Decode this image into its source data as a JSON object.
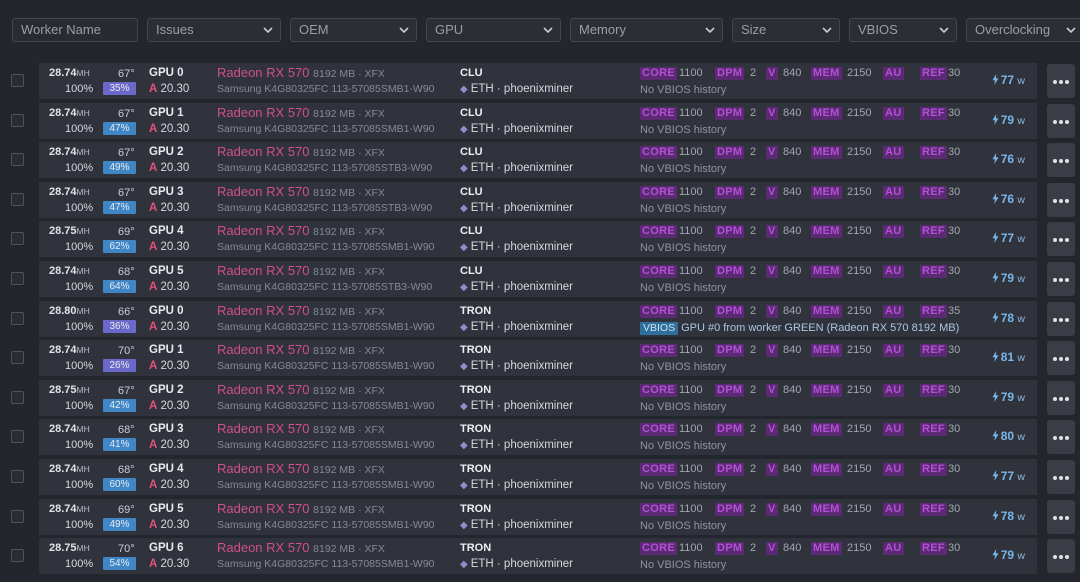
{
  "filters": {
    "worker_name_placeholder": "Worker Name",
    "issues": "Issues",
    "oem": "OEM",
    "gpu": "GPU",
    "memory": "Memory",
    "size": "Size",
    "vbios": "VBIOS",
    "overclocking": "Overclocking"
  },
  "oc_labels": {
    "core": "CORE",
    "dpm": "DPM",
    "v": "V",
    "mem": "MEM",
    "au": "AU",
    "ref": "REF"
  },
  "colors": {
    "accent_pink": "#d04f8c",
    "oc_tag_bg": "#5a2a73",
    "fan_blue": "#3f86c6",
    "fan_purple": "#6a68c8",
    "power_blue": "#78b6ea"
  },
  "rows": [
    {
      "hash": "28.74",
      "hash_unit": "MH",
      "pct": "100%",
      "temp": "67°",
      "fan": "35%",
      "fan_color": "purple",
      "gpu": "GPU 0",
      "amp_label": "A",
      "amp": "20.30",
      "model": "Radeon RX 570",
      "spec": "8192 MB · XFX",
      "memory": "Samsung K4G80325FC 113-57085SMB1-W90",
      "worker": "CLU",
      "algo": "ETH · phoenixminer",
      "core": "1100",
      "dpm": "2",
      "v": "840",
      "mem": "2150",
      "au": "",
      "ref": "30",
      "vbios_tag": "",
      "vbios_text": "No VBIOS history",
      "power": "77",
      "power_unit": "w"
    },
    {
      "hash": "28.74",
      "hash_unit": "MH",
      "pct": "100%",
      "temp": "67°",
      "fan": "47%",
      "fan_color": "blue",
      "gpu": "GPU 1",
      "amp_label": "A",
      "amp": "20.30",
      "model": "Radeon RX 570",
      "spec": "8192 MB · XFX",
      "memory": "Samsung K4G80325FC 113-57085SMB1-W90",
      "worker": "CLU",
      "algo": "ETH · phoenixminer",
      "core": "1100",
      "dpm": "2",
      "v": "840",
      "mem": "2150",
      "au": "",
      "ref": "30",
      "vbios_tag": "",
      "vbios_text": "No VBIOS history",
      "power": "79",
      "power_unit": "w"
    },
    {
      "hash": "28.74",
      "hash_unit": "MH",
      "pct": "100%",
      "temp": "67°",
      "fan": "49%",
      "fan_color": "blue",
      "gpu": "GPU 2",
      "amp_label": "A",
      "amp": "20.30",
      "model": "Radeon RX 570",
      "spec": "8192 MB · XFX",
      "memory": "Samsung K4G80325FC 113-57085STB3-W90",
      "worker": "CLU",
      "algo": "ETH · phoenixminer",
      "core": "1100",
      "dpm": "2",
      "v": "840",
      "mem": "2150",
      "au": "",
      "ref": "30",
      "vbios_tag": "",
      "vbios_text": "No VBIOS history",
      "power": "76",
      "power_unit": "w"
    },
    {
      "hash": "28.74",
      "hash_unit": "MH",
      "pct": "100%",
      "temp": "67°",
      "fan": "47%",
      "fan_color": "blue",
      "gpu": "GPU 3",
      "amp_label": "A",
      "amp": "20.30",
      "model": "Radeon RX 570",
      "spec": "8192 MB · XFX",
      "memory": "Samsung K4G80325FC 113-57085STB3-W90",
      "worker": "CLU",
      "algo": "ETH · phoenixminer",
      "core": "1100",
      "dpm": "2",
      "v": "840",
      "mem": "2150",
      "au": "",
      "ref": "30",
      "vbios_tag": "",
      "vbios_text": "No VBIOS history",
      "power": "76",
      "power_unit": "w"
    },
    {
      "hash": "28.75",
      "hash_unit": "MH",
      "pct": "100%",
      "temp": "69°",
      "fan": "62%",
      "fan_color": "blue",
      "gpu": "GPU 4",
      "amp_label": "A",
      "amp": "20.30",
      "model": "Radeon RX 570",
      "spec": "8192 MB · XFX",
      "memory": "Samsung K4G80325FC 113-57085SMB1-W90",
      "worker": "CLU",
      "algo": "ETH · phoenixminer",
      "core": "1100",
      "dpm": "2",
      "v": "840",
      "mem": "2150",
      "au": "",
      "ref": "30",
      "vbios_tag": "",
      "vbios_text": "No VBIOS history",
      "power": "77",
      "power_unit": "w"
    },
    {
      "hash": "28.74",
      "hash_unit": "MH",
      "pct": "100%",
      "temp": "68°",
      "fan": "64%",
      "fan_color": "blue",
      "gpu": "GPU 5",
      "amp_label": "A",
      "amp": "20.30",
      "model": "Radeon RX 570",
      "spec": "8192 MB · XFX",
      "memory": "Samsung K4G80325FC 113-57085STB3-W90",
      "worker": "CLU",
      "algo": "ETH · phoenixminer",
      "core": "1100",
      "dpm": "2",
      "v": "840",
      "mem": "2150",
      "au": "",
      "ref": "30",
      "vbios_tag": "",
      "vbios_text": "No VBIOS history",
      "power": "79",
      "power_unit": "w"
    },
    {
      "hash": "28.80",
      "hash_unit": "MH",
      "pct": "100%",
      "temp": "66°",
      "fan": "36%",
      "fan_color": "purple",
      "gpu": "GPU 0",
      "amp_label": "A",
      "amp": "20.30",
      "model": "Radeon RX 570",
      "spec": "8192 MB · XFX",
      "memory": "Samsung K4G80325FC 113-57085SMB1-W90",
      "worker": "TRON",
      "algo": "ETH · phoenixminer",
      "core": "1100",
      "dpm": "2",
      "v": "840",
      "mem": "2150",
      "au": "",
      "ref": "35",
      "vbios_tag": "VBIOS",
      "vbios_text": "GPU #0 from worker GREEN (Radeon RX 570 8192 MB)",
      "power": "78",
      "power_unit": "w"
    },
    {
      "hash": "28.74",
      "hash_unit": "MH",
      "pct": "100%",
      "temp": "70°",
      "fan": "26%",
      "fan_color": "purple",
      "gpu": "GPU 1",
      "amp_label": "A",
      "amp": "20.30",
      "model": "Radeon RX 570",
      "spec": "8192 MB · XFX",
      "memory": "Samsung K4G80325FC 113-57085SMB1-W90",
      "worker": "TRON",
      "algo": "ETH · phoenixminer",
      "core": "1100",
      "dpm": "2",
      "v": "840",
      "mem": "2150",
      "au": "",
      "ref": "30",
      "vbios_tag": "",
      "vbios_text": "No VBIOS history",
      "power": "81",
      "power_unit": "w"
    },
    {
      "hash": "28.75",
      "hash_unit": "MH",
      "pct": "100%",
      "temp": "67°",
      "fan": "42%",
      "fan_color": "blue",
      "gpu": "GPU 2",
      "amp_label": "A",
      "amp": "20.30",
      "model": "Radeon RX 570",
      "spec": "8192 MB · XFX",
      "memory": "Samsung K4G80325FC 113-57085SMB1-W90",
      "worker": "TRON",
      "algo": "ETH · phoenixminer",
      "core": "1100",
      "dpm": "2",
      "v": "840",
      "mem": "2150",
      "au": "",
      "ref": "30",
      "vbios_tag": "",
      "vbios_text": "No VBIOS history",
      "power": "79",
      "power_unit": "w"
    },
    {
      "hash": "28.74",
      "hash_unit": "MH",
      "pct": "100%",
      "temp": "68°",
      "fan": "41%",
      "fan_color": "blue",
      "gpu": "GPU 3",
      "amp_label": "A",
      "amp": "20.30",
      "model": "Radeon RX 570",
      "spec": "8192 MB · XFX",
      "memory": "Samsung K4G80325FC 113-57085SMB1-W90",
      "worker": "TRON",
      "algo": "ETH · phoenixminer",
      "core": "1100",
      "dpm": "2",
      "v": "840",
      "mem": "2150",
      "au": "",
      "ref": "30",
      "vbios_tag": "",
      "vbios_text": "No VBIOS history",
      "power": "80",
      "power_unit": "w"
    },
    {
      "hash": "28.74",
      "hash_unit": "MH",
      "pct": "100%",
      "temp": "68°",
      "fan": "60%",
      "fan_color": "blue",
      "gpu": "GPU 4",
      "amp_label": "A",
      "amp": "20.30",
      "model": "Radeon RX 570",
      "spec": "8192 MB · XFX",
      "memory": "Samsung K4G80325FC 113-57085SMB1-W90",
      "worker": "TRON",
      "algo": "ETH · phoenixminer",
      "core": "1100",
      "dpm": "2",
      "v": "840",
      "mem": "2150",
      "au": "",
      "ref": "30",
      "vbios_tag": "",
      "vbios_text": "No VBIOS history",
      "power": "77",
      "power_unit": "w"
    },
    {
      "hash": "28.74",
      "hash_unit": "MH",
      "pct": "100%",
      "temp": "69°",
      "fan": "49%",
      "fan_color": "blue",
      "gpu": "GPU 5",
      "amp_label": "A",
      "amp": "20.30",
      "model": "Radeon RX 570",
      "spec": "8192 MB · XFX",
      "memory": "Samsung K4G80325FC 113-57085SMB1-W90",
      "worker": "TRON",
      "algo": "ETH · phoenixminer",
      "core": "1100",
      "dpm": "2",
      "v": "840",
      "mem": "2150",
      "au": "",
      "ref": "30",
      "vbios_tag": "",
      "vbios_text": "No VBIOS history",
      "power": "78",
      "power_unit": "w"
    },
    {
      "hash": "28.75",
      "hash_unit": "MH",
      "pct": "100%",
      "temp": "70°",
      "fan": "54%",
      "fan_color": "blue",
      "gpu": "GPU 6",
      "amp_label": "A",
      "amp": "20.30",
      "model": "Radeon RX 570",
      "spec": "8192 MB · XFX",
      "memory": "Samsung K4G80325FC 113-57085SMB1-W90",
      "worker": "TRON",
      "algo": "ETH · phoenixminer",
      "core": "1100",
      "dpm": "2",
      "v": "840",
      "mem": "2150",
      "au": "",
      "ref": "30",
      "vbios_tag": "",
      "vbios_text": "No VBIOS history",
      "power": "79",
      "power_unit": "w"
    }
  ]
}
